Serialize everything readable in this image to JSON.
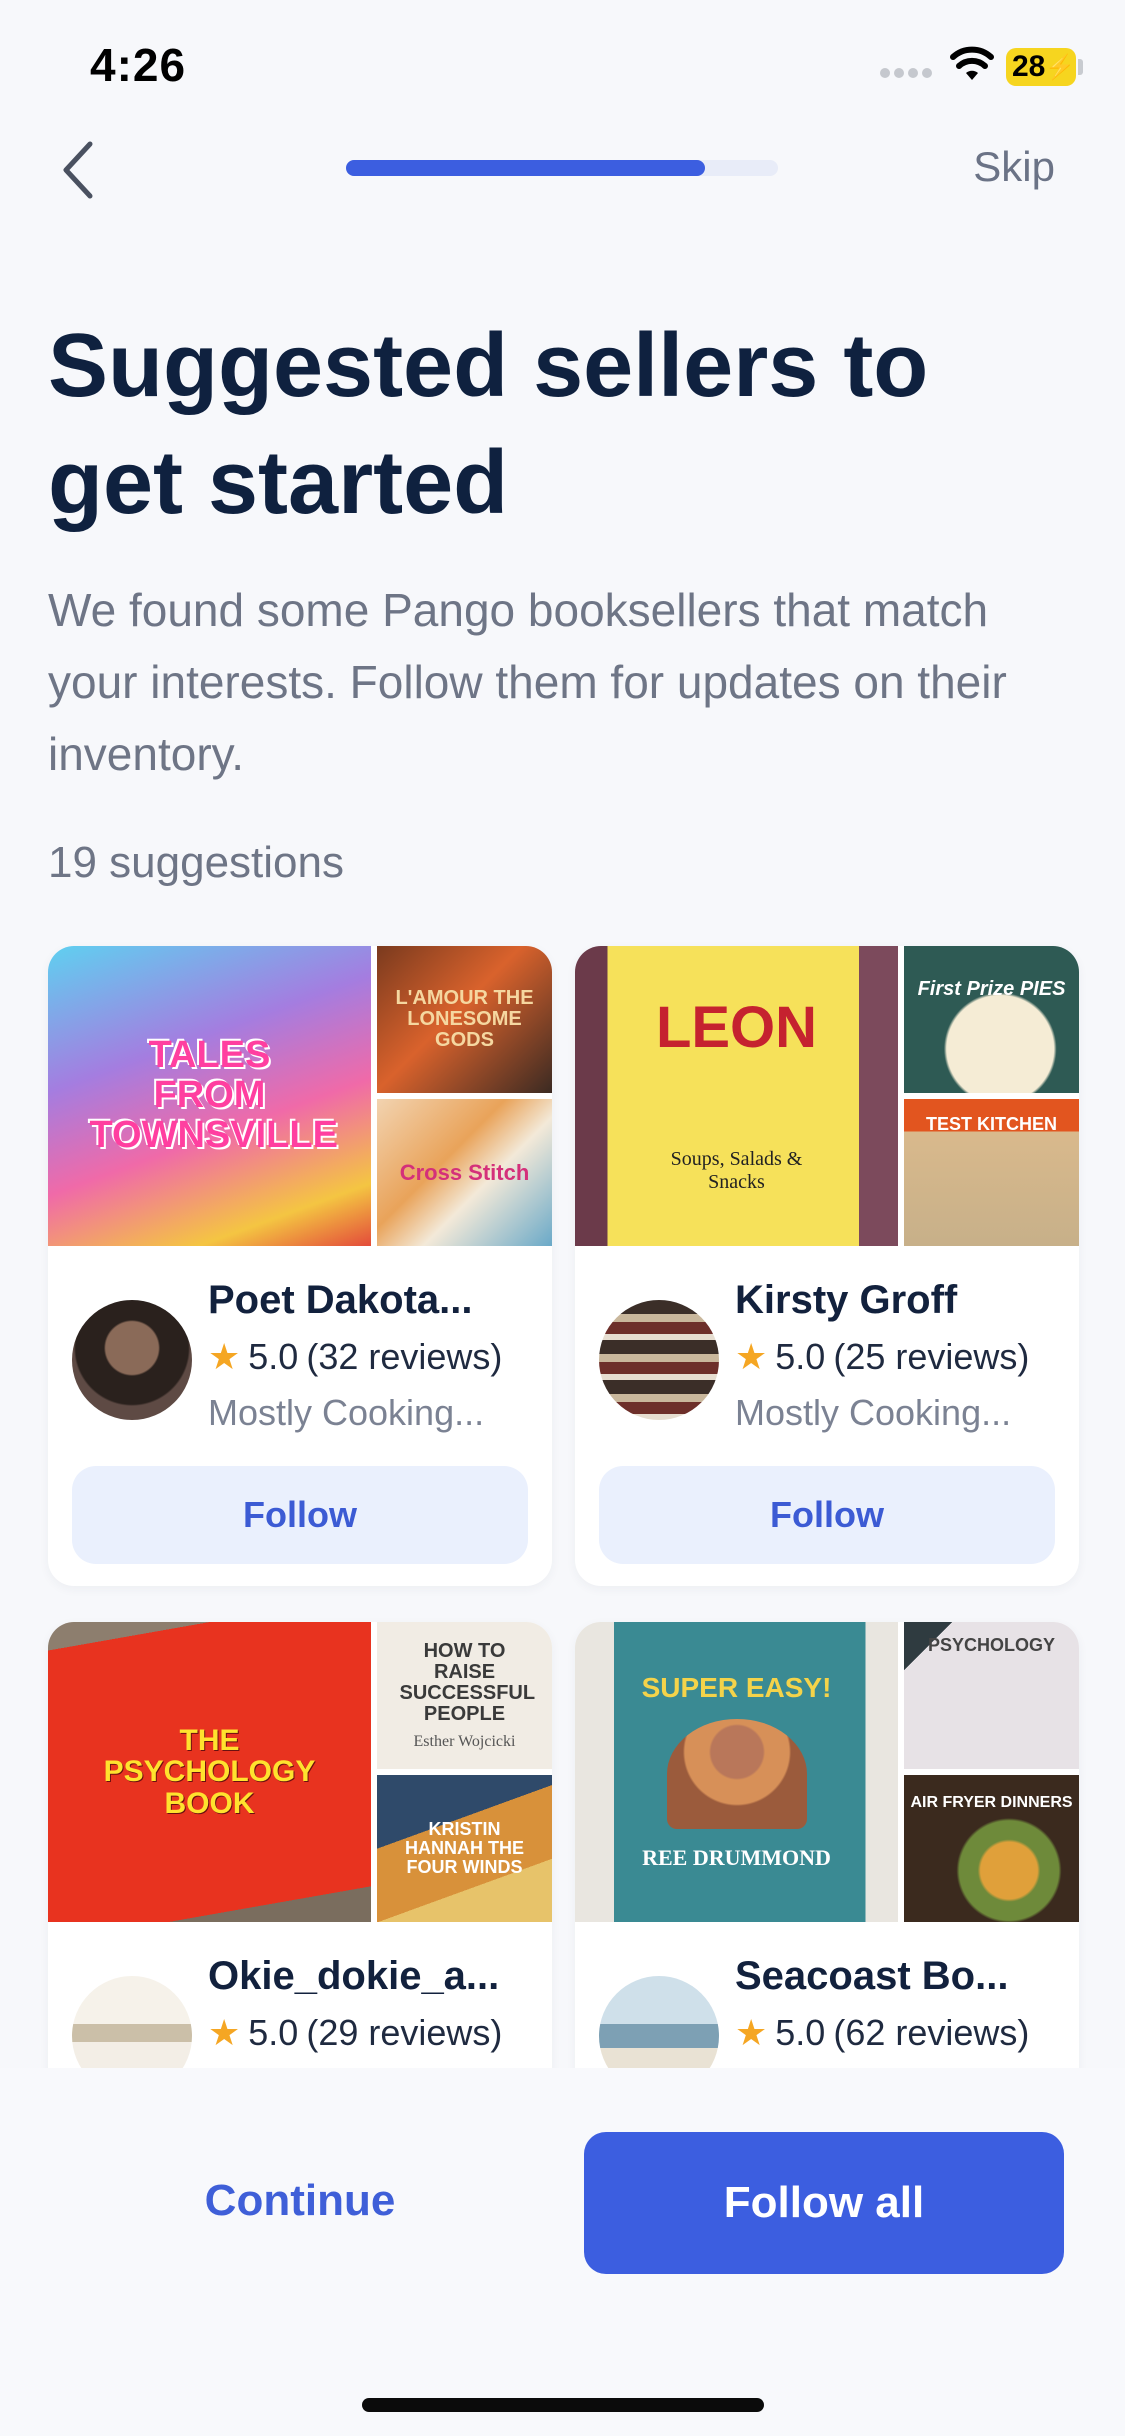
{
  "status": {
    "time": "4:26",
    "battery": "28"
  },
  "nav": {
    "skip": "Skip",
    "progress": 0.83
  },
  "header": {
    "title": "Suggested sellers to get started",
    "subtitle": "We found some Pango booksellers that match your interests. Follow them for updates on their inventory.",
    "count": "19 suggestions"
  },
  "sellers": [
    {
      "name": "Poet Dakota...",
      "rating": "5.0",
      "reviews": "(32 reviews)",
      "genre": "Mostly Cooking...",
      "follow": "Follow",
      "cover_main": "TALES FROM TOWNSVILLE",
      "cover_a": "L'AMOUR THE LONESOME GODS",
      "cover_b": "Cross Stitch"
    },
    {
      "name": "Kirsty Groff",
      "rating": "5.0",
      "reviews": "(25 reviews)",
      "genre": "Mostly Cooking...",
      "follow": "Follow",
      "cover_main": "LEON",
      "cover_main_sub": "Soups, Salads & Snacks",
      "cover_a": "First Prize PIES",
      "cover_b": "TEST KITCHEN"
    },
    {
      "name": "Okie_dokie_a...",
      "rating": "5.0",
      "reviews": "(29 reviews)",
      "cover_main": "THE PSYCHOLOGY BOOK",
      "cover_a": "HOW TO RAISE SUCCESSFUL PEOPLE",
      "cover_a_sub": "Esther Wojcicki",
      "cover_b": "KRISTIN HANNAH THE FOUR WINDS"
    },
    {
      "name": "Seacoast Bo...",
      "rating": "5.0",
      "reviews": "(62 reviews)",
      "cover_main": "SUPER EASY!",
      "cover_main_sub": "REE DRUMMOND",
      "cover_a": "PSYCHOLOGY",
      "cover_b": "AIR FRYER DINNERS"
    }
  ],
  "footer": {
    "continue": "Continue",
    "follow_all": "Follow all"
  }
}
